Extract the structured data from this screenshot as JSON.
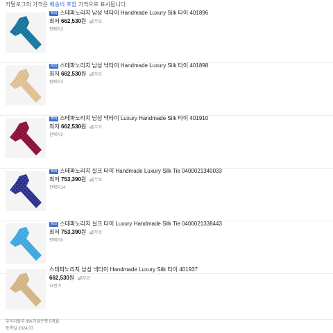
{
  "notice": {
    "prefix": "카탈로그의 가격은 ",
    "emphasis": "배송비 포함",
    "suffix": " 가격으로 표시됩니다."
  },
  "items": [
    {
      "tag": "해외",
      "title": "스테파노리치 남성 넥타이 Handmade Luxury Silk 타이 401896",
      "price_label": "최저",
      "price": "662,530",
      "unit": "원",
      "shipping": "무료",
      "seller": "판매처3",
      "tie_color": "#1f7fa8",
      "tie_pattern": "#0d4d6b",
      "icon": "necktie-icon"
    },
    {
      "tag": "해외",
      "title": "스테파노리치 남성 넥타이 Handmade Luxury Silk 타이 401898",
      "price_label": "최저",
      "price": "662,530",
      "unit": "원",
      "shipping": "무료",
      "seller": "판매처3",
      "tie_color": "#e3c59a",
      "tie_pattern": "#cfa976",
      "icon": "necktie-icon"
    },
    {
      "tag": "해외",
      "title": "스테파노리치 남성 넥타이 Luxury Handmade Silk 타이 401910",
      "price_label": "최저",
      "price": "662,530",
      "unit": "원",
      "shipping": "무료",
      "seller": "판매처2",
      "tie_color": "#8a1238",
      "tie_pattern": "#c2275a",
      "icon": "necktie-icon"
    },
    {
      "tag": "해외",
      "title": "스테파노리치 실크 타이 Handmade Luxury Silk Tie 0400021340033",
      "price_label": "최저",
      "price": "753,390",
      "unit": "원",
      "shipping": "무료",
      "seller": "판매처14",
      "tie_color": "#2b2f86",
      "tie_pattern": "#6d74d4",
      "icon": "necktie-icon"
    },
    {
      "tag": "해외",
      "title": "스테파노리치 실크 타이 Luxury Handmade Silk Tie 0400021338443",
      "price_label": "최저",
      "price": "753,390",
      "unit": "원",
      "shipping": "무료",
      "seller": "판매처8",
      "tie_color": "#3ea6dc",
      "tie_pattern": "#7cc7ee",
      "icon": "necktie-icon"
    },
    {
      "tag": "",
      "title": "스테파노리치 남성 넥타이 Handmade Luxury Silk 타이 401937",
      "price_label": "",
      "price": "662,530",
      "unit": "원",
      "shipping": "무료",
      "seller": "11번가",
      "tie_color": "#d8b98a",
      "tie_pattern": "#c29f6e",
      "icon": "necktie-icon"
    }
  ],
  "footer": {
    "line1": "무이자할부 IBK기업은행 5개월",
    "line2": "등록일 2024.07."
  }
}
